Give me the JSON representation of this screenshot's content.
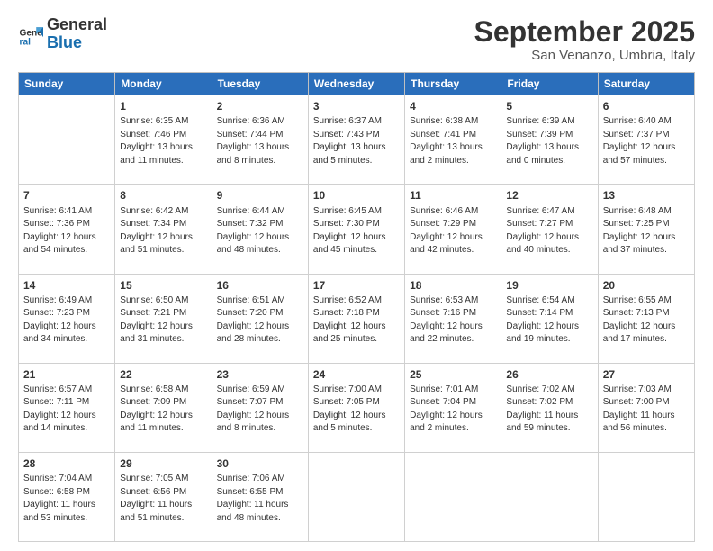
{
  "logo": {
    "general": "General",
    "blue": "Blue"
  },
  "title": "September 2025",
  "subtitle": "San Venanzo, Umbria, Italy",
  "weekdays": [
    "Sunday",
    "Monday",
    "Tuesday",
    "Wednesday",
    "Thursday",
    "Friday",
    "Saturday"
  ],
  "weeks": [
    [
      {
        "day": "",
        "info": ""
      },
      {
        "day": "1",
        "info": "Sunrise: 6:35 AM\nSunset: 7:46 PM\nDaylight: 13 hours\nand 11 minutes."
      },
      {
        "day": "2",
        "info": "Sunrise: 6:36 AM\nSunset: 7:44 PM\nDaylight: 13 hours\nand 8 minutes."
      },
      {
        "day": "3",
        "info": "Sunrise: 6:37 AM\nSunset: 7:43 PM\nDaylight: 13 hours\nand 5 minutes."
      },
      {
        "day": "4",
        "info": "Sunrise: 6:38 AM\nSunset: 7:41 PM\nDaylight: 13 hours\nand 2 minutes."
      },
      {
        "day": "5",
        "info": "Sunrise: 6:39 AM\nSunset: 7:39 PM\nDaylight: 13 hours\nand 0 minutes."
      },
      {
        "day": "6",
        "info": "Sunrise: 6:40 AM\nSunset: 7:37 PM\nDaylight: 12 hours\nand 57 minutes."
      }
    ],
    [
      {
        "day": "7",
        "info": "Sunrise: 6:41 AM\nSunset: 7:36 PM\nDaylight: 12 hours\nand 54 minutes."
      },
      {
        "day": "8",
        "info": "Sunrise: 6:42 AM\nSunset: 7:34 PM\nDaylight: 12 hours\nand 51 minutes."
      },
      {
        "day": "9",
        "info": "Sunrise: 6:44 AM\nSunset: 7:32 PM\nDaylight: 12 hours\nand 48 minutes."
      },
      {
        "day": "10",
        "info": "Sunrise: 6:45 AM\nSunset: 7:30 PM\nDaylight: 12 hours\nand 45 minutes."
      },
      {
        "day": "11",
        "info": "Sunrise: 6:46 AM\nSunset: 7:29 PM\nDaylight: 12 hours\nand 42 minutes."
      },
      {
        "day": "12",
        "info": "Sunrise: 6:47 AM\nSunset: 7:27 PM\nDaylight: 12 hours\nand 40 minutes."
      },
      {
        "day": "13",
        "info": "Sunrise: 6:48 AM\nSunset: 7:25 PM\nDaylight: 12 hours\nand 37 minutes."
      }
    ],
    [
      {
        "day": "14",
        "info": "Sunrise: 6:49 AM\nSunset: 7:23 PM\nDaylight: 12 hours\nand 34 minutes."
      },
      {
        "day": "15",
        "info": "Sunrise: 6:50 AM\nSunset: 7:21 PM\nDaylight: 12 hours\nand 31 minutes."
      },
      {
        "day": "16",
        "info": "Sunrise: 6:51 AM\nSunset: 7:20 PM\nDaylight: 12 hours\nand 28 minutes."
      },
      {
        "day": "17",
        "info": "Sunrise: 6:52 AM\nSunset: 7:18 PM\nDaylight: 12 hours\nand 25 minutes."
      },
      {
        "day": "18",
        "info": "Sunrise: 6:53 AM\nSunset: 7:16 PM\nDaylight: 12 hours\nand 22 minutes."
      },
      {
        "day": "19",
        "info": "Sunrise: 6:54 AM\nSunset: 7:14 PM\nDaylight: 12 hours\nand 19 minutes."
      },
      {
        "day": "20",
        "info": "Sunrise: 6:55 AM\nSunset: 7:13 PM\nDaylight: 12 hours\nand 17 minutes."
      }
    ],
    [
      {
        "day": "21",
        "info": "Sunrise: 6:57 AM\nSunset: 7:11 PM\nDaylight: 12 hours\nand 14 minutes."
      },
      {
        "day": "22",
        "info": "Sunrise: 6:58 AM\nSunset: 7:09 PM\nDaylight: 12 hours\nand 11 minutes."
      },
      {
        "day": "23",
        "info": "Sunrise: 6:59 AM\nSunset: 7:07 PM\nDaylight: 12 hours\nand 8 minutes."
      },
      {
        "day": "24",
        "info": "Sunrise: 7:00 AM\nSunset: 7:05 PM\nDaylight: 12 hours\nand 5 minutes."
      },
      {
        "day": "25",
        "info": "Sunrise: 7:01 AM\nSunset: 7:04 PM\nDaylight: 12 hours\nand 2 minutes."
      },
      {
        "day": "26",
        "info": "Sunrise: 7:02 AM\nSunset: 7:02 PM\nDaylight: 11 hours\nand 59 minutes."
      },
      {
        "day": "27",
        "info": "Sunrise: 7:03 AM\nSunset: 7:00 PM\nDaylight: 11 hours\nand 56 minutes."
      }
    ],
    [
      {
        "day": "28",
        "info": "Sunrise: 7:04 AM\nSunset: 6:58 PM\nDaylight: 11 hours\nand 53 minutes."
      },
      {
        "day": "29",
        "info": "Sunrise: 7:05 AM\nSunset: 6:56 PM\nDaylight: 11 hours\nand 51 minutes."
      },
      {
        "day": "30",
        "info": "Sunrise: 7:06 AM\nSunset: 6:55 PM\nDaylight: 11 hours\nand 48 minutes."
      },
      {
        "day": "",
        "info": ""
      },
      {
        "day": "",
        "info": ""
      },
      {
        "day": "",
        "info": ""
      },
      {
        "day": "",
        "info": ""
      }
    ]
  ]
}
